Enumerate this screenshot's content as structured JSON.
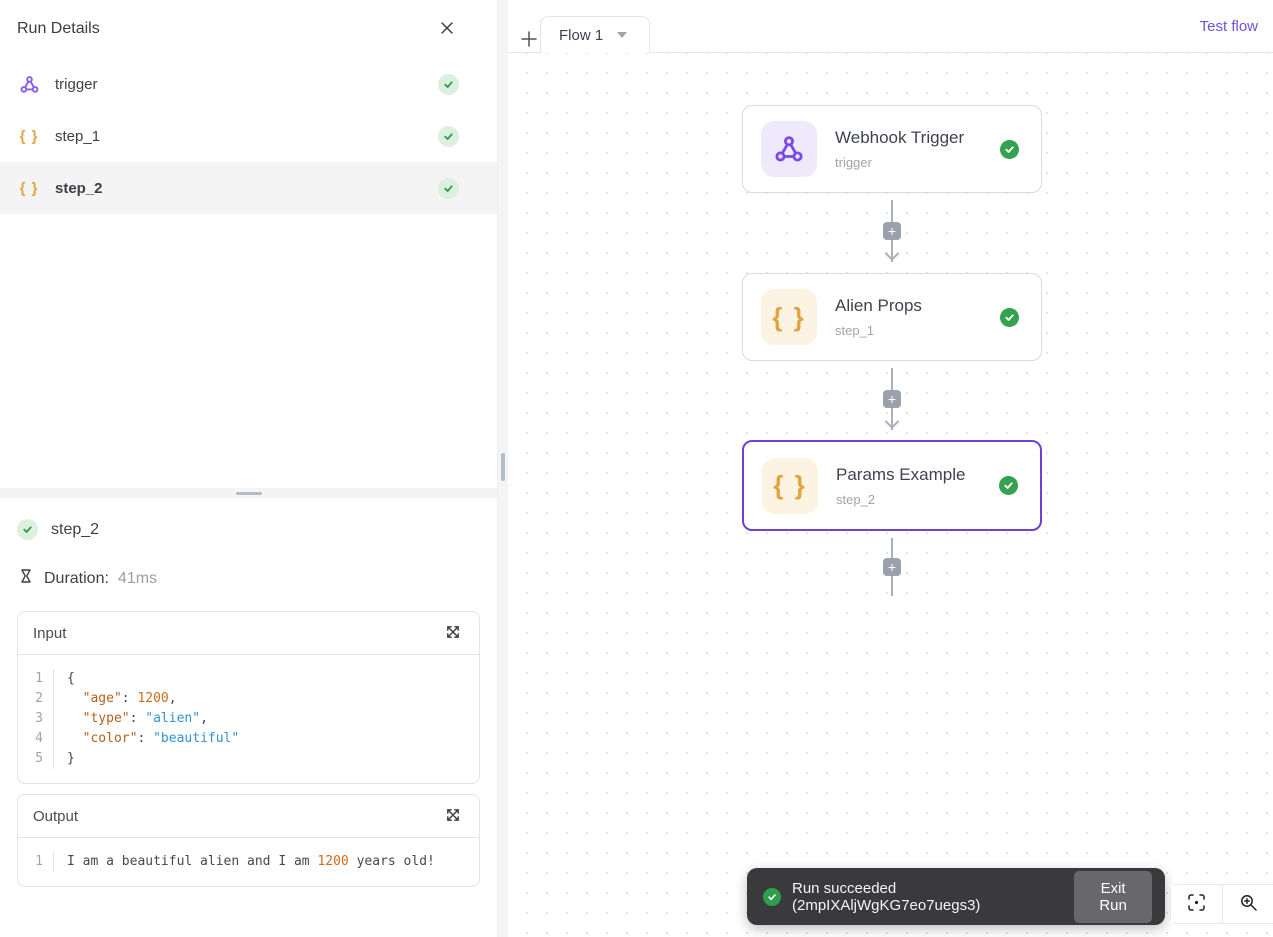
{
  "icons": {
    "braces_glyph": "{ }",
    "plus_glyph": "+"
  },
  "run_details": {
    "title": "Run Details",
    "steps": [
      {
        "name": "trigger",
        "status": "success"
      },
      {
        "name": "step_1",
        "status": "success"
      },
      {
        "name": "step_2",
        "status": "success",
        "selected": true
      }
    ]
  },
  "step_details": {
    "name": "step_2",
    "status": "success",
    "duration_label": "Duration:",
    "duration_value": "41ms",
    "input": {
      "title": "Input",
      "line_numbers": [
        "1",
        "2",
        "3",
        "4",
        "5"
      ],
      "lines": [
        [
          "{"
        ],
        [
          "  ",
          "\"age\"",
          ": ",
          "1200",
          ","
        ],
        [
          "  ",
          "\"type\"",
          ": ",
          "\"alien\"",
          ","
        ],
        [
          "  ",
          "\"color\"",
          ": ",
          "\"beautiful\""
        ],
        [
          "}"
        ]
      ]
    },
    "output": {
      "title": "Output",
      "line_numbers": [
        "1"
      ],
      "lines": [
        [
          "I am a beautiful alien and I am ",
          "1200",
          " years old!"
        ]
      ]
    }
  },
  "canvas": {
    "tabs": [
      {
        "label": "Flow 1",
        "active": true
      }
    ],
    "test_flow_label": "Test flow",
    "nodes": [
      {
        "title": "Webhook Trigger",
        "subtitle": "trigger",
        "status": "success"
      },
      {
        "title": "Alien Props",
        "subtitle": "step_1",
        "status": "success"
      },
      {
        "title": "Params Example",
        "subtitle": "step_2",
        "status": "success",
        "selected": true
      }
    ],
    "toast": {
      "message": "Run succeeded (2mpIXAljWgKG7eo7uegs3)",
      "button_label": "Exit Run"
    },
    "colors": {
      "accent_purple": "#6d41d1",
      "success_green": "#34a24e",
      "link_purple": "#6e52e0"
    }
  }
}
